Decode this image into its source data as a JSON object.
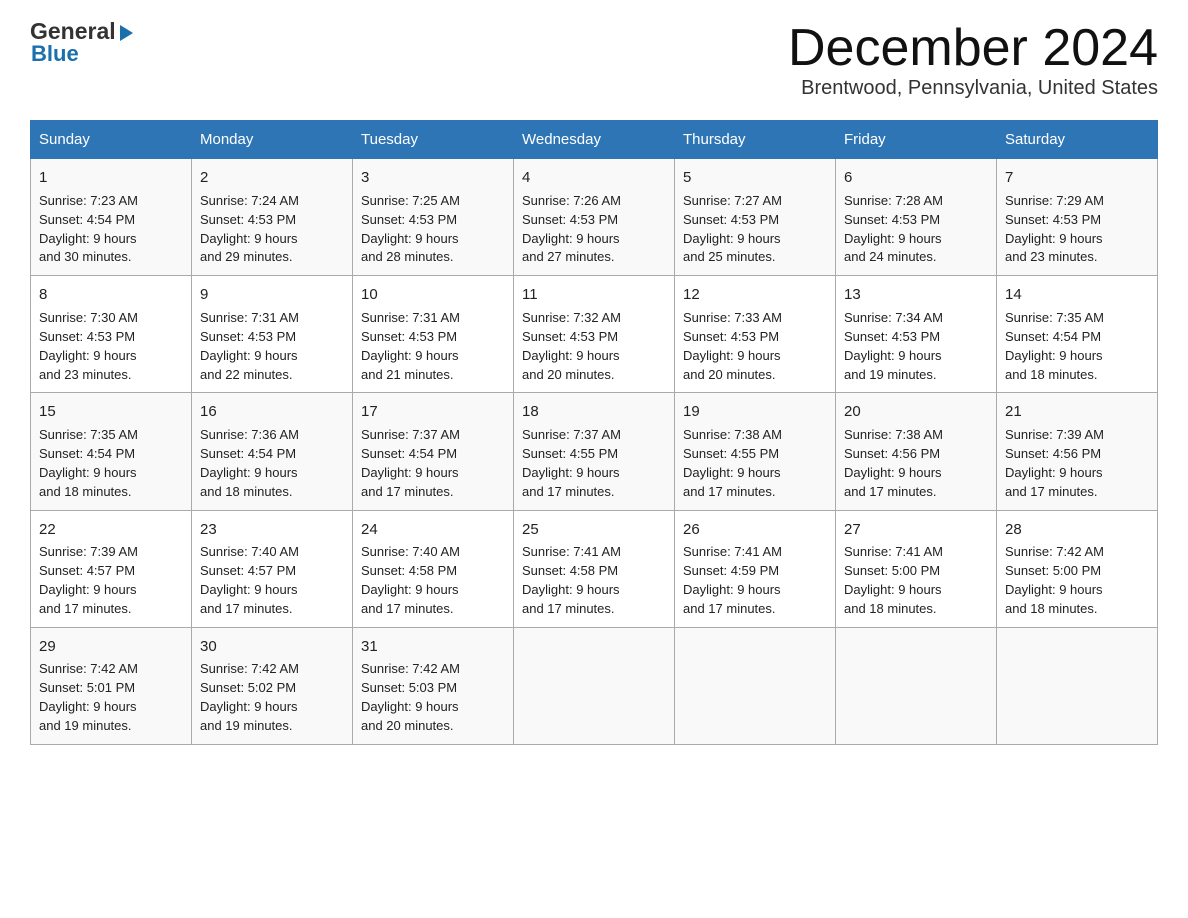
{
  "logo": {
    "general": "General",
    "blue": "Blue"
  },
  "title": "December 2024",
  "location": "Brentwood, Pennsylvania, United States",
  "days_of_week": [
    "Sunday",
    "Monday",
    "Tuesday",
    "Wednesday",
    "Thursday",
    "Friday",
    "Saturday"
  ],
  "weeks": [
    [
      {
        "day": "1",
        "sunrise": "7:23 AM",
        "sunset": "4:54 PM",
        "daylight": "9 hours and 30 minutes."
      },
      {
        "day": "2",
        "sunrise": "7:24 AM",
        "sunset": "4:53 PM",
        "daylight": "9 hours and 29 minutes."
      },
      {
        "day": "3",
        "sunrise": "7:25 AM",
        "sunset": "4:53 PM",
        "daylight": "9 hours and 28 minutes."
      },
      {
        "day": "4",
        "sunrise": "7:26 AM",
        "sunset": "4:53 PM",
        "daylight": "9 hours and 27 minutes."
      },
      {
        "day": "5",
        "sunrise": "7:27 AM",
        "sunset": "4:53 PM",
        "daylight": "9 hours and 25 minutes."
      },
      {
        "day": "6",
        "sunrise": "7:28 AM",
        "sunset": "4:53 PM",
        "daylight": "9 hours and 24 minutes."
      },
      {
        "day": "7",
        "sunrise": "7:29 AM",
        "sunset": "4:53 PM",
        "daylight": "9 hours and 23 minutes."
      }
    ],
    [
      {
        "day": "8",
        "sunrise": "7:30 AM",
        "sunset": "4:53 PM",
        "daylight": "9 hours and 23 minutes."
      },
      {
        "day": "9",
        "sunrise": "7:31 AM",
        "sunset": "4:53 PM",
        "daylight": "9 hours and 22 minutes."
      },
      {
        "day": "10",
        "sunrise": "7:31 AM",
        "sunset": "4:53 PM",
        "daylight": "9 hours and 21 minutes."
      },
      {
        "day": "11",
        "sunrise": "7:32 AM",
        "sunset": "4:53 PM",
        "daylight": "9 hours and 20 minutes."
      },
      {
        "day": "12",
        "sunrise": "7:33 AM",
        "sunset": "4:53 PM",
        "daylight": "9 hours and 20 minutes."
      },
      {
        "day": "13",
        "sunrise": "7:34 AM",
        "sunset": "4:53 PM",
        "daylight": "9 hours and 19 minutes."
      },
      {
        "day": "14",
        "sunrise": "7:35 AM",
        "sunset": "4:54 PM",
        "daylight": "9 hours and 18 minutes."
      }
    ],
    [
      {
        "day": "15",
        "sunrise": "7:35 AM",
        "sunset": "4:54 PM",
        "daylight": "9 hours and 18 minutes."
      },
      {
        "day": "16",
        "sunrise": "7:36 AM",
        "sunset": "4:54 PM",
        "daylight": "9 hours and 18 minutes."
      },
      {
        "day": "17",
        "sunrise": "7:37 AM",
        "sunset": "4:54 PM",
        "daylight": "9 hours and 17 minutes."
      },
      {
        "day": "18",
        "sunrise": "7:37 AM",
        "sunset": "4:55 PM",
        "daylight": "9 hours and 17 minutes."
      },
      {
        "day": "19",
        "sunrise": "7:38 AM",
        "sunset": "4:55 PM",
        "daylight": "9 hours and 17 minutes."
      },
      {
        "day": "20",
        "sunrise": "7:38 AM",
        "sunset": "4:56 PM",
        "daylight": "9 hours and 17 minutes."
      },
      {
        "day": "21",
        "sunrise": "7:39 AM",
        "sunset": "4:56 PM",
        "daylight": "9 hours and 17 minutes."
      }
    ],
    [
      {
        "day": "22",
        "sunrise": "7:39 AM",
        "sunset": "4:57 PM",
        "daylight": "9 hours and 17 minutes."
      },
      {
        "day": "23",
        "sunrise": "7:40 AM",
        "sunset": "4:57 PM",
        "daylight": "9 hours and 17 minutes."
      },
      {
        "day": "24",
        "sunrise": "7:40 AM",
        "sunset": "4:58 PM",
        "daylight": "9 hours and 17 minutes."
      },
      {
        "day": "25",
        "sunrise": "7:41 AM",
        "sunset": "4:58 PM",
        "daylight": "9 hours and 17 minutes."
      },
      {
        "day": "26",
        "sunrise": "7:41 AM",
        "sunset": "4:59 PM",
        "daylight": "9 hours and 17 minutes."
      },
      {
        "day": "27",
        "sunrise": "7:41 AM",
        "sunset": "5:00 PM",
        "daylight": "9 hours and 18 minutes."
      },
      {
        "day": "28",
        "sunrise": "7:42 AM",
        "sunset": "5:00 PM",
        "daylight": "9 hours and 18 minutes."
      }
    ],
    [
      {
        "day": "29",
        "sunrise": "7:42 AM",
        "sunset": "5:01 PM",
        "daylight": "9 hours and 19 minutes."
      },
      {
        "day": "30",
        "sunrise": "7:42 AM",
        "sunset": "5:02 PM",
        "daylight": "9 hours and 19 minutes."
      },
      {
        "day": "31",
        "sunrise": "7:42 AM",
        "sunset": "5:03 PM",
        "daylight": "9 hours and 20 minutes."
      },
      null,
      null,
      null,
      null
    ]
  ],
  "labels": {
    "sunrise": "Sunrise:",
    "sunset": "Sunset:",
    "daylight": "Daylight:"
  },
  "colors": {
    "header_bg": "#2e75b6",
    "header_text": "#ffffff",
    "border": "#aaaaaa",
    "logo_blue": "#1a6fad"
  }
}
